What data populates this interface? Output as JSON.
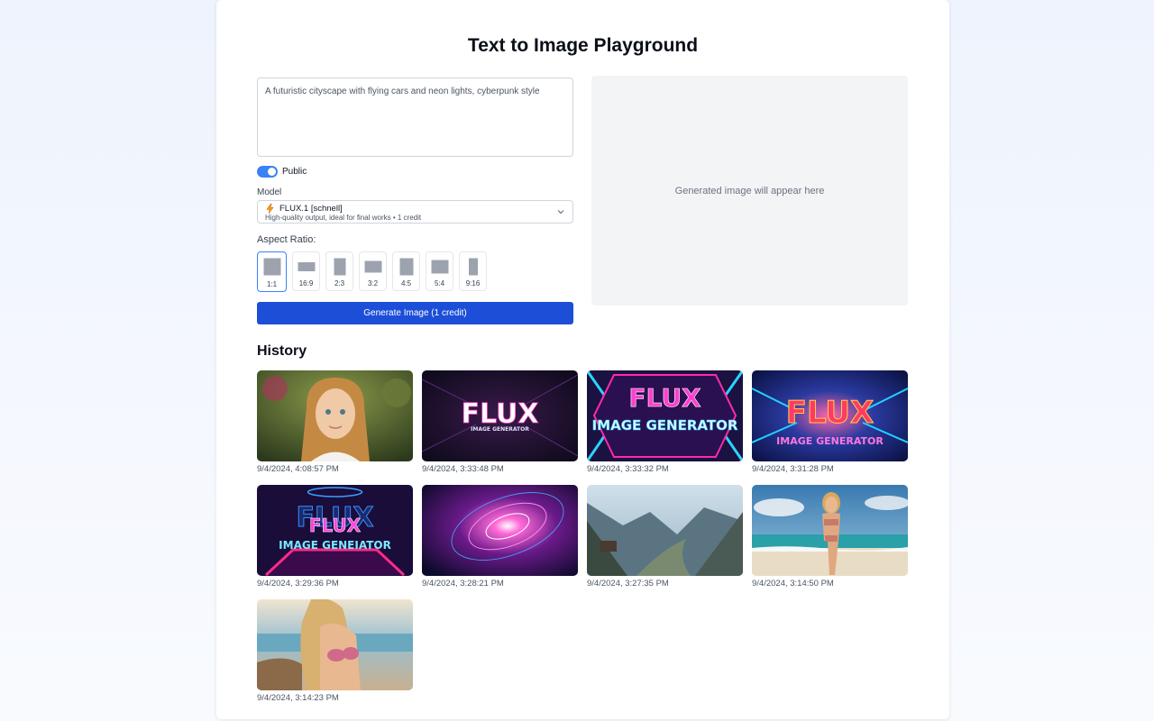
{
  "page": {
    "title": "Text to Image Playground"
  },
  "prompt": {
    "value": "A futuristic cityscape with flying cars and neon lights, cyberpunk style"
  },
  "visibility": {
    "label": "Public",
    "on": true
  },
  "model": {
    "label": "Model",
    "name": "FLUX.1 [schnell]",
    "description": "High-quality output, ideal for final works • 1 credit",
    "icon": "lightning-bolt-icon"
  },
  "aspect": {
    "label": "Aspect Ratio:",
    "selected": "1:1",
    "options": [
      "1:1",
      "16:9",
      "2:3",
      "3:2",
      "4:5",
      "5:4",
      "9:16"
    ]
  },
  "generate": {
    "label": "Generate Image (1 credit)"
  },
  "preview": {
    "placeholder": "Generated image will appear here"
  },
  "history": {
    "title": "History",
    "items": [
      {
        "timestamp": "9/4/2024, 4:08:57 PM",
        "image": "portrait-girl-braids"
      },
      {
        "timestamp": "9/4/2024, 3:33:48 PM",
        "image": "flux-logo-dark",
        "text": "FLUX",
        "sub": "IMAGE GENERATOR"
      },
      {
        "timestamp": "9/4/2024, 3:33:32 PM",
        "image": "flux-neon-hex",
        "text": "FLUX",
        "sub": "IMAGE GENERATOR"
      },
      {
        "timestamp": "9/4/2024, 3:31:28 PM",
        "image": "flux-neon-blue",
        "text": "FLUX",
        "sub": "IMAGE GENERATOR"
      },
      {
        "timestamp": "9/4/2024, 3:29:36 PM",
        "image": "flux-neon-grid",
        "text": "FLUX",
        "sub": "IMAGE GENEIATOR"
      },
      {
        "timestamp": "9/4/2024, 3:28:21 PM",
        "image": "cosmic-swirl"
      },
      {
        "timestamp": "9/4/2024, 3:27:35 PM",
        "image": "mountain-valley"
      },
      {
        "timestamp": "9/4/2024, 3:14:50 PM",
        "image": "beach-woman-standing"
      },
      {
        "timestamp": "9/4/2024, 3:14:23 PM",
        "image": "beach-woman-closeup"
      }
    ]
  },
  "colors": {
    "accent": "#1d4ed8",
    "toggle": "#3b82f6",
    "preview_bg": "#f3f4f6"
  }
}
